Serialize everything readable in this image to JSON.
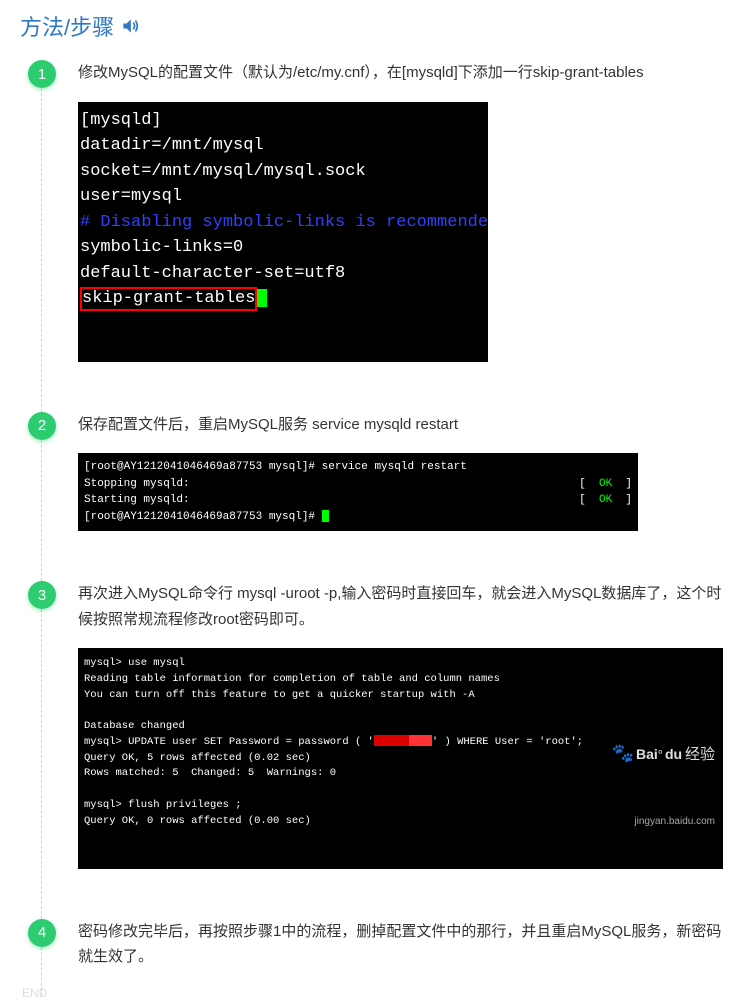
{
  "header": {
    "title": "方法/步骤"
  },
  "steps": [
    {
      "num": "1",
      "text": "修改MySQL的配置文件（默认为/etc/my.cnf），在[mysqld]下添加一行skip-grant-tables",
      "terminal1": {
        "l1": "[mysqld]",
        "l2": "datadir=/mnt/mysql",
        "l3": "socket=/mnt/mysql/mysql.sock",
        "l4": "user=mysql",
        "l5": "# Disabling symbolic-links is recommende",
        "l6": "symbolic-links=0",
        "l7": "default-character-set=utf8",
        "l8": "skip-grant-tables"
      }
    },
    {
      "num": "2",
      "text": "保存配置文件后，重启MySQL服务 service mysqld restart",
      "terminal2": {
        "l1_left": "[root@AY1212041046469a87753 mysql]# ",
        "l1_cmd": "service mysqld restart",
        "l2_left": "Stopping mysqld:",
        "l2_right": "[  OK  ]",
        "l3_left": "Starting mysqld:",
        "l3_right": "[  OK  ]",
        "l4": "[root@AY1212041046469a87753 mysql]# "
      }
    },
    {
      "num": "3",
      "text": "再次进入MySQL命令行 mysql -uroot -p,输入密码时直接回车，就会进入MySQL数据库了，这个时候按照常规流程修改root密码即可。",
      "terminal3": {
        "l1": "mysql> use mysql",
        "l2": "Reading table information for completion of table and column names",
        "l3": "You can turn off this feature to get a quicker startup with -A",
        "l4": "",
        "l5": "Database changed",
        "l6a": "mysql> UPDATE user SET Password = password ( '",
        "l6b": "' ) WHERE User = 'root';",
        "l7": "Query OK, 5 rows affected (0.02 sec)",
        "l8": "Rows matched: 5  Changed: 5  Warnings: 0",
        "l9": "",
        "l10": "mysql> flush privileges ;",
        "l11": "Query OK, 0 rows affected (0.00 sec)"
      },
      "watermark": {
        "brand": "Bai",
        "brand2": "du",
        "chinese": "经验",
        "url": "jingyan.baidu.com"
      }
    },
    {
      "num": "4",
      "text": "密码修改完毕后，再按照步骤1中的流程，删掉配置文件中的那行，并且重启MySQL服务，新密码就生效了。"
    }
  ],
  "end_label": "END"
}
